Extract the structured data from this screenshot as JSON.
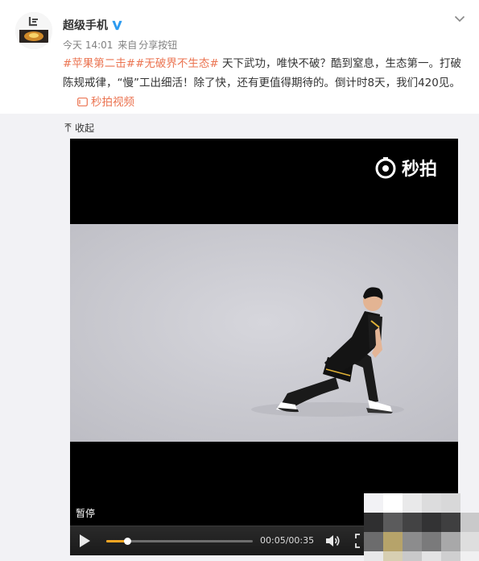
{
  "post": {
    "username": "超级手机",
    "verified_icon": "verified-v-icon",
    "time": "今天 14:01",
    "source_prefix": "来自",
    "source": "分享按钮",
    "hashtag1": "#苹果第二击#",
    "hashtag2": "#无破界不生态#",
    "body": " 天下武功，唯快不破？酷到窒息，生态第一。打破陈规戒律，“慢”工出细活！除了快，还有更值得期待的。倒计时8天，我们420见。",
    "video_link_label": "秒拍视频",
    "accent_color": "#eb7350"
  },
  "media": {
    "collapse_label": "收起",
    "watermark": "秒拍",
    "pause_label": "暂停",
    "time_display": "00:05/00:35",
    "progress": 0.143
  },
  "icons": {
    "chevron": "chevron-down-icon",
    "collapse": "arrow-up-icon",
    "play": "play-icon",
    "volume": "volume-icon",
    "fullscreen": "fullscreen-icon"
  }
}
